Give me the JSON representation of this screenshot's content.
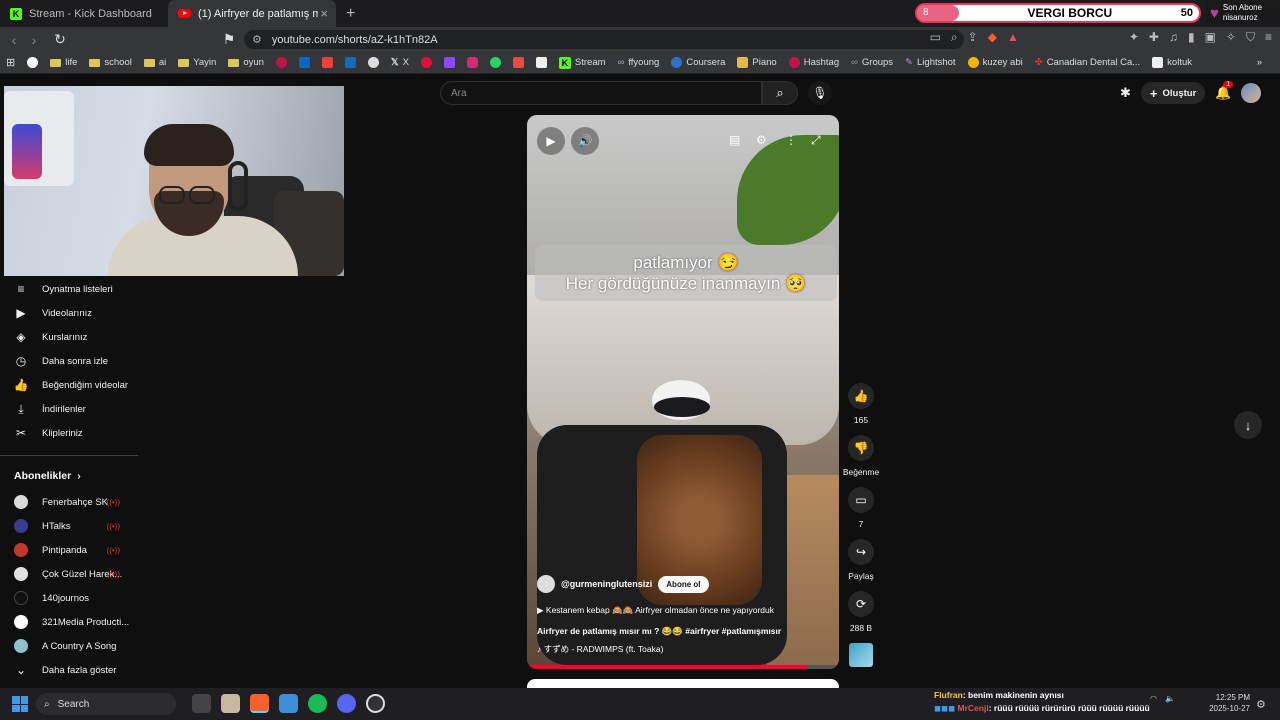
{
  "tabs": [
    {
      "label": "Stream - Kick Dashboard",
      "active": false
    },
    {
      "label": "(1) Airfryer de patlamış mısır mı",
      "active": true
    }
  ],
  "overlay": {
    "count": "8",
    "name": "VERGI BORCU",
    "value": "50",
    "progress_fraction": 0.15
  },
  "subscriber_box": {
    "line1": "Son Abone",
    "line2": "nisanuroz"
  },
  "address": {
    "url": "youtube.com/shorts/aZ-k1hTn82A"
  },
  "bookmarks": [
    "life",
    "school",
    "ai",
    "Yayin",
    "oyun",
    "X",
    "Stream",
    "ffyoung",
    "Coursera",
    "Piano",
    "Hashtag",
    "Groups",
    "Lightshot",
    "kuzey abi",
    "Canadian Dental Ca...",
    "koltuk"
  ],
  "search": {
    "placeholder": "Ara"
  },
  "header": {
    "create_label": "Oluştur",
    "notif_count": "1"
  },
  "sidebar": {
    "items": [
      {
        "label": "Oynatma listeleri",
        "icon": "playlist-icon"
      },
      {
        "label": "Videolarınız",
        "icon": "video-icon"
      },
      {
        "label": "Kurslarınız",
        "icon": "course-icon"
      },
      {
        "label": "Daha sonra izle",
        "icon": "clock-icon"
      },
      {
        "label": "Beğendiğim videolar",
        "icon": "thumbs-up-icon"
      },
      {
        "label": "İndirilenler",
        "icon": "download-icon"
      },
      {
        "label": "Klipleriniz",
        "icon": "scissors-icon"
      }
    ],
    "subs_heading": "Abonelikler",
    "subscriptions": [
      {
        "label": "Fenerbahçe SK",
        "live": true,
        "color": "#d9d9d9"
      },
      {
        "label": "HTalks",
        "live": true,
        "color": "#3b3b8f"
      },
      {
        "label": "Pintipanda",
        "live": true,
        "color": "#c0392b"
      },
      {
        "label": "Çok Güzel Harek...",
        "live": true,
        "color": "#e0e0e0"
      },
      {
        "label": "140journos",
        "live": false,
        "color": "#111111"
      },
      {
        "label": "321Media Producti...",
        "live": false,
        "color": "#ffffff"
      },
      {
        "label": "A Country A Song",
        "live": false,
        "color": "#8ec0d0"
      }
    ],
    "show_more": "Daha fazla göster"
  },
  "short": {
    "caption_line1": "patlamıyor 😏",
    "caption_line2": "Her gördüğünüze inanmayın 🥺",
    "channel": "@gurmeninglutensizi",
    "subscribe_label": "Abone ol",
    "playlist_line": "▶  Kestanem kebap 🙈🙈 Airfryer olmadan önce ne yapıyorduk",
    "title": "Airfryer de patlamış mısır mı ? 😂😂 #airfryer #patlamışmısır",
    "music": "♪ すずめ - RADWIMPS (ft. Toaka)"
  },
  "actions": {
    "likes": "165",
    "dislike_label": "Beğenme",
    "comments": "7",
    "share_label": "Paylaş",
    "remix_count": "288 B"
  },
  "taskbar": {
    "search_label": "Search"
  },
  "chat": {
    "user1": "Flufran",
    "msg1": ": benim makinenin aynısı",
    "user2": "MrCenji",
    "msg2": ": rüüü rüüüü rürürürü rüüü rüüüü rüüüü"
  },
  "tray": {
    "lang": "ENG",
    "time": "12:25 PM",
    "date": "2025-10-27"
  }
}
